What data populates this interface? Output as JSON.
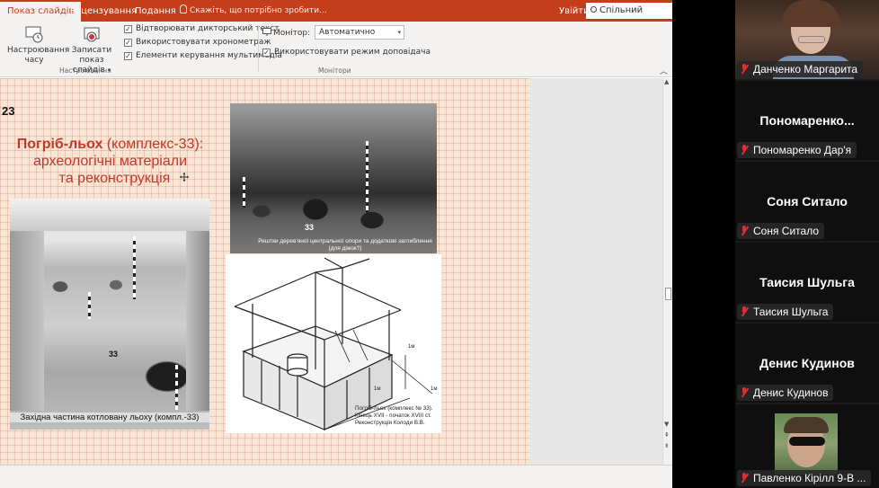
{
  "ribbon_tabs": {
    "slideshow": "Показ слайдів",
    "review": "Рецензування",
    "view": "Подання",
    "tell_me": "Скажіть, що потрібно зробити...",
    "sign_in": "Увійти",
    "share": "Спільний доступ"
  },
  "ribbon": {
    "rehearse_timings": "Настроювання часу",
    "record_show": "Записати показ слайдів",
    "record_show_arrow": "▾",
    "group_setup": "Настроювання",
    "play_narrations": "Відтворювати дикторський текст",
    "use_timings": "Використовувати хронометраж",
    "media_controls": "Елементи керування мультимедіа",
    "monitor_label": "Монітор:",
    "monitor_value": "Автоматично",
    "presenter_view": "Використовувати режим доповідача",
    "group_monitors": "Монітори",
    "checkmark": "✓"
  },
  "slide": {
    "number": "23",
    "title_bold": "Погріб-льох",
    "title_rest": " (комплекс-33):",
    "title_line2": "археологічні матеріали",
    "title_line3": "та реконструкція",
    "photo_top_tag": "33",
    "photo_top_caption": "Рештки дерев'яної центральної опори та додаткові заглиблення (для діжок?)",
    "photo_left_tag": "33",
    "photo_left_caption": "Західна частина котловану льоху (компл.-33)",
    "drawing_caption_1": "Погріб-льох (комплекс № 33).",
    "drawing_caption_2": "Кінець XVII - початок XVIII ст.",
    "drawing_caption_3": "Реконструкція Колоди В.В.",
    "dim_label": "1м"
  },
  "participants": [
    {
      "name_large": "",
      "label": "Данченко Маргарита",
      "has_video": true
    },
    {
      "name_large": "Пономаренко...",
      "label": "Пономаренко Дар'я",
      "has_video": false
    },
    {
      "name_large": "Соня Ситало",
      "label": "Соня Ситало",
      "has_video": false
    },
    {
      "name_large": "Таисия Шульга",
      "label": "Таисия Шульга",
      "has_video": false
    },
    {
      "name_large": "Денис Кудинов",
      "label": "Денис Кудинов",
      "has_video": false
    },
    {
      "name_large": "",
      "label": "Павленко Кірілл 9-В ...",
      "has_video": true
    }
  ],
  "colors": {
    "ppt_accent": "#c43e1c",
    "title_red": "#c0392b",
    "mic_muted": "#e02f2f"
  }
}
